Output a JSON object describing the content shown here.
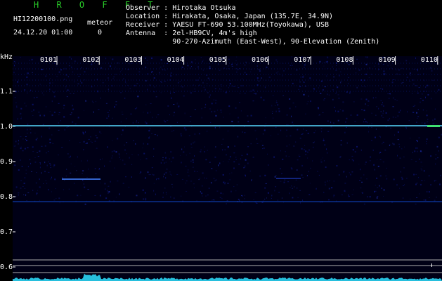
{
  "header": {
    "app_title": "H R O F F T",
    "file_name": "HI12200100.png",
    "datetime": "24.12.20 01:00",
    "meteor_label": "meteor",
    "meteor_count": "0"
  },
  "station": {
    "observer": "Observer : Hirotaka Otsuka",
    "location": "Location : Hirakata, Osaka, Japan (135.7E, 34.9N)",
    "receiver": "Receiver : YAESU FT-690 53.100MHz(Toyokawa), USB",
    "antenna": "Antenna  : 2el-HB9CV, 4m's high",
    "antenna_2": "           90-270-Azimuth (East-West), 90-Elevation (Zenith)"
  },
  "axis": {
    "unit": "kHz",
    "y_ticks": [
      "1.1",
      "1.0",
      "0.9",
      "0.8",
      "0.7",
      "0.6"
    ],
    "x_ticks": [
      "0101",
      "0102",
      "0103",
      "0104",
      "0105",
      "0106",
      "0107",
      "0108",
      "0109",
      "0110"
    ]
  },
  "colors": {
    "background": "#000000",
    "plot_background": "#000016",
    "label_green": "#2ad12a",
    "carrier": "#2f9ad0",
    "noise": "#0b1470",
    "spectrum": "#29c9e8"
  }
}
